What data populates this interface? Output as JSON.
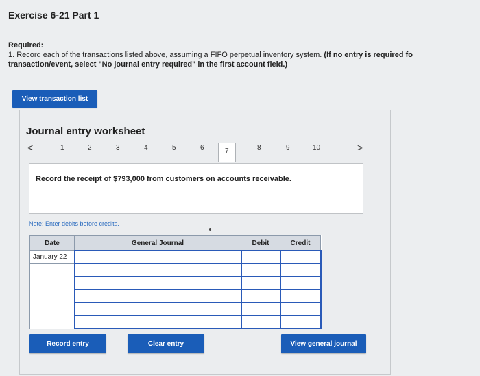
{
  "page": {
    "title": "Exercise 6-21 Part 1",
    "required_label": "Required:",
    "instruction_main": "1. Record each of the transactions listed above, assuming a FIFO perpetual inventory system. ",
    "instruction_bold_a": "(If no entry is required fo",
    "instruction_bold_b": "transaction/event, select \"No journal entry required\" in the first account field.)"
  },
  "buttons": {
    "view_transaction_list": "View transaction list",
    "record_entry": "Record entry",
    "clear_entry": "Clear entry",
    "view_general_journal": "View general journal"
  },
  "worksheet": {
    "title": "Journal entry worksheet",
    "prev_symbol": "<",
    "next_symbol": ">",
    "tabs": [
      "1",
      "2",
      "3",
      "4",
      "5",
      "6",
      "7",
      "8",
      "9",
      "10"
    ],
    "active_tab": "7",
    "description": "Record the receipt of $793,000 from customers on accounts receivable.",
    "note": "Note: Enter debits before credits."
  },
  "journal": {
    "headers": {
      "date": "Date",
      "account": "General Journal",
      "debit": "Debit",
      "credit": "Credit"
    },
    "rows": [
      {
        "date": "January 22",
        "account": "",
        "debit": "",
        "credit": ""
      },
      {
        "date": "",
        "account": "",
        "debit": "",
        "credit": ""
      },
      {
        "date": "",
        "account": "",
        "debit": "",
        "credit": ""
      },
      {
        "date": "",
        "account": "",
        "debit": "",
        "credit": ""
      },
      {
        "date": "",
        "account": "",
        "debit": "",
        "credit": ""
      },
      {
        "date": "",
        "account": "",
        "debit": "",
        "credit": ""
      }
    ]
  }
}
